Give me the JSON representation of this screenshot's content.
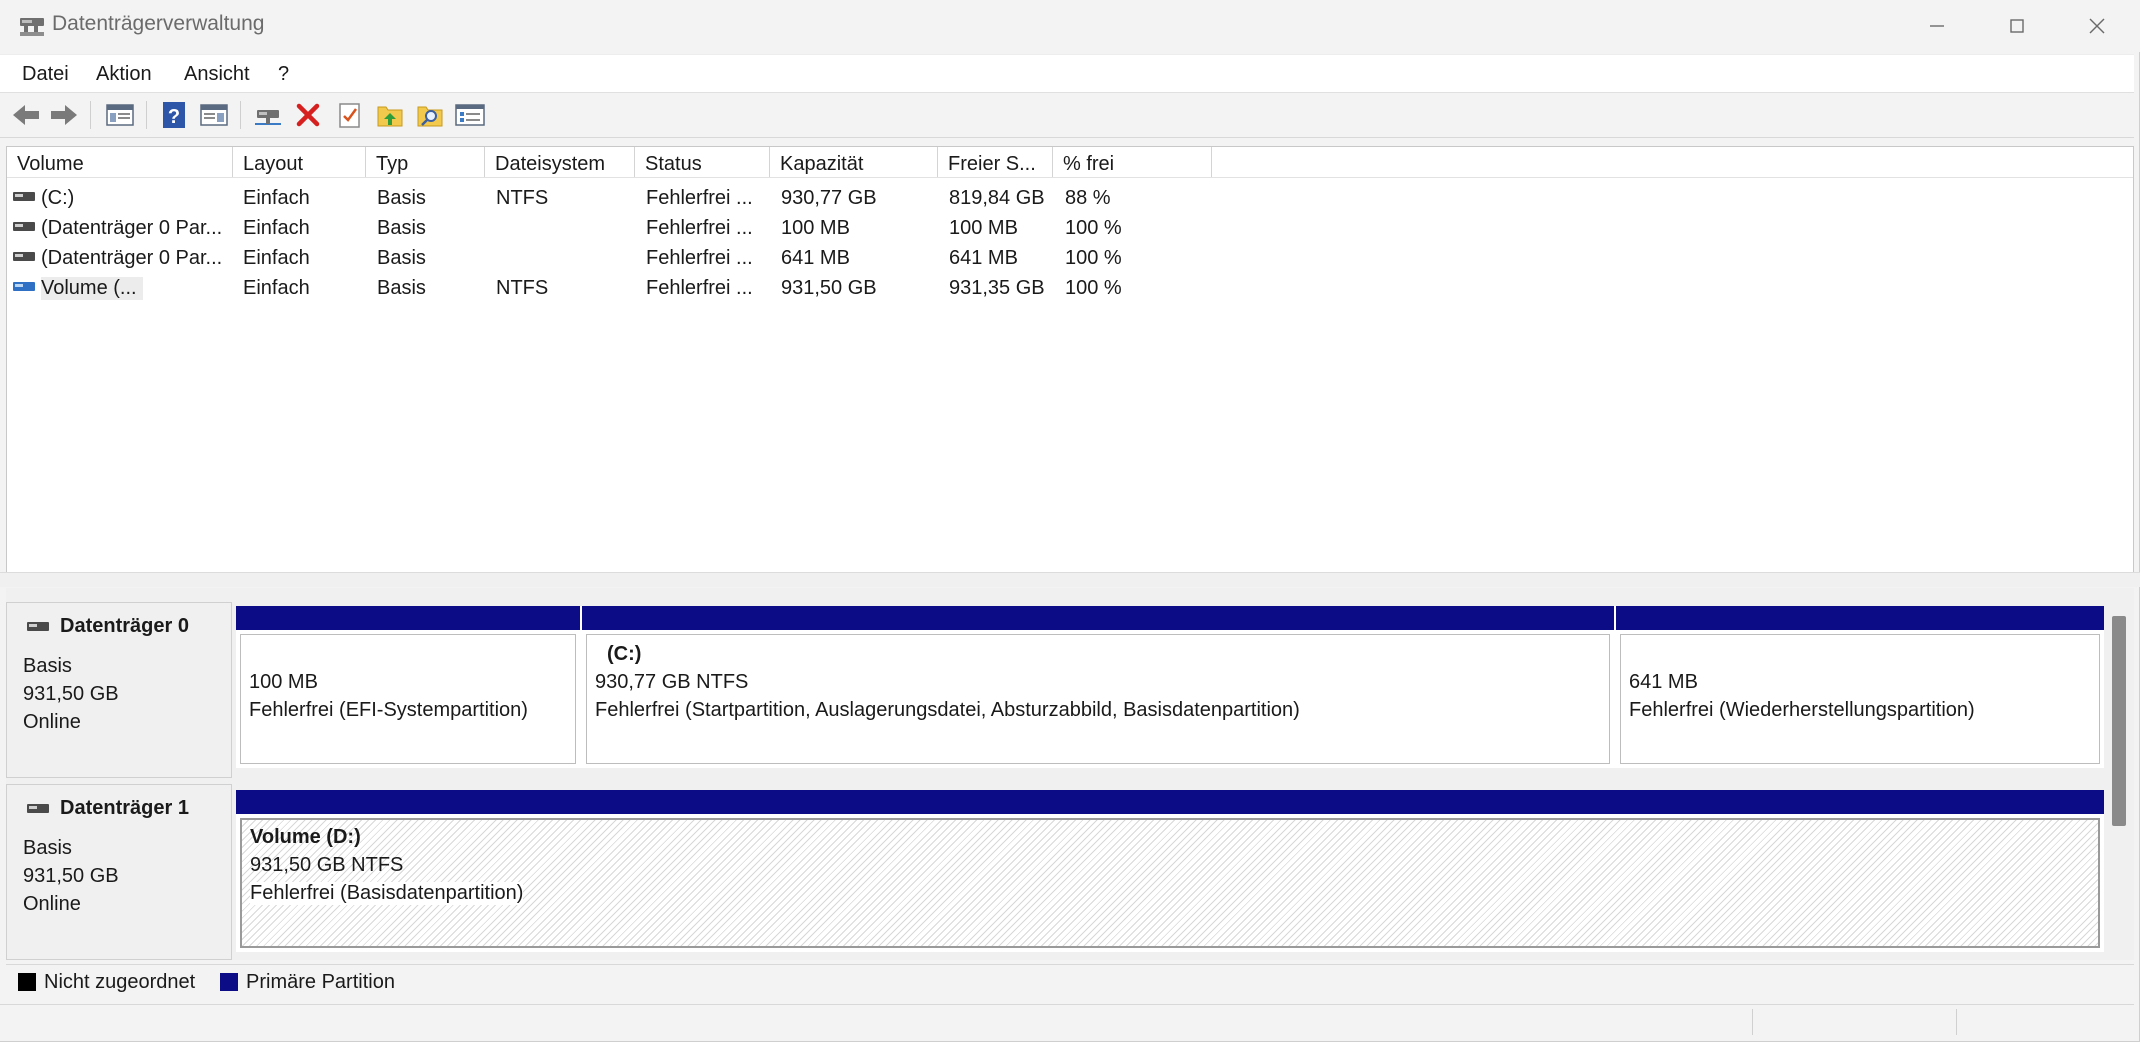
{
  "window": {
    "title": "Datenträgerverwaltung"
  },
  "menu": {
    "items": [
      "Datei",
      "Aktion",
      "Ansicht",
      "?"
    ]
  },
  "toolbar": {
    "buttons": [
      "back-arrow-icon",
      "forward-arrow-icon",
      "show-hide-console-tree-icon",
      "help-icon",
      "properties-pane-icon",
      "connect-drive-icon",
      "delete-icon",
      "checklist-icon",
      "folder-up-icon",
      "folder-search-icon",
      "settings-list-icon"
    ]
  },
  "volume_list": {
    "columns": [
      "Volume",
      "Layout",
      "Typ",
      "Dateisystem",
      "Status",
      "Kapazität",
      "Freier S...",
      "% frei"
    ],
    "rows": [
      {
        "volume": " (C:)",
        "layout": "Einfach",
        "typ": "Basis",
        "dateisystem": "NTFS",
        "status": "Fehlerfrei ...",
        "kapazitaet": "930,77 GB",
        "frei": "819,84 GB",
        "prozent": "88 %",
        "icon": "disk-drive-icon"
      },
      {
        "volume": "(Datenträger 0 Par...",
        "layout": "Einfach",
        "typ": "Basis",
        "dateisystem": "",
        "status": "Fehlerfrei ...",
        "kapazitaet": "100 MB",
        "frei": "100 MB",
        "prozent": "100 %",
        "icon": "disk-drive-icon"
      },
      {
        "volume": "(Datenträger 0 Par...",
        "layout": "Einfach",
        "typ": "Basis",
        "dateisystem": "",
        "status": "Fehlerfrei ...",
        "kapazitaet": "641 MB",
        "frei": "641 MB",
        "prozent": "100 %",
        "icon": "disk-drive-icon"
      },
      {
        "volume": "Volume (...",
        "layout": "Einfach",
        "typ": "Basis",
        "dateisystem": "NTFS",
        "status": "Fehlerfrei ...",
        "kapazitaet": "931,50 GB",
        "frei": "931,35 GB",
        "prozent": "100 %",
        "icon": "volume-blue-icon"
      }
    ]
  },
  "disks": [
    {
      "name": "Datenträger 0",
      "type": "Basis",
      "size": "931,50 GB",
      "state": "Online",
      "partitions": [
        {
          "title": "",
          "line1": "100 MB",
          "line2": "Fehlerfrei (EFI-Systempartition)"
        },
        {
          "title": "(C:)",
          "line1": "930,77 GB NTFS",
          "line2": "Fehlerfrei (Startpartition, Auslagerungsdatei, Absturzabbild, Basisdatenpartition)"
        },
        {
          "title": "",
          "line1": "641 MB",
          "line2": "Fehlerfrei (Wiederherstellungspartition)"
        }
      ]
    },
    {
      "name": "Datenträger 1",
      "type": "Basis",
      "size": "931,50 GB",
      "state": "Online",
      "partitions": [
        {
          "title": "Volume  (D:)",
          "line1": "931,50 GB NTFS",
          "line2": "Fehlerfrei (Basisdatenpartition)"
        }
      ]
    }
  ],
  "legend": [
    {
      "label": "Nicht zugeordnet",
      "color": "#000000"
    },
    {
      "label": "Primäre Partition",
      "color": "#0b0c86"
    }
  ],
  "colors": {
    "primary_partition_bar": "#0b0c86",
    "window_bg": "#f3f3f3"
  }
}
